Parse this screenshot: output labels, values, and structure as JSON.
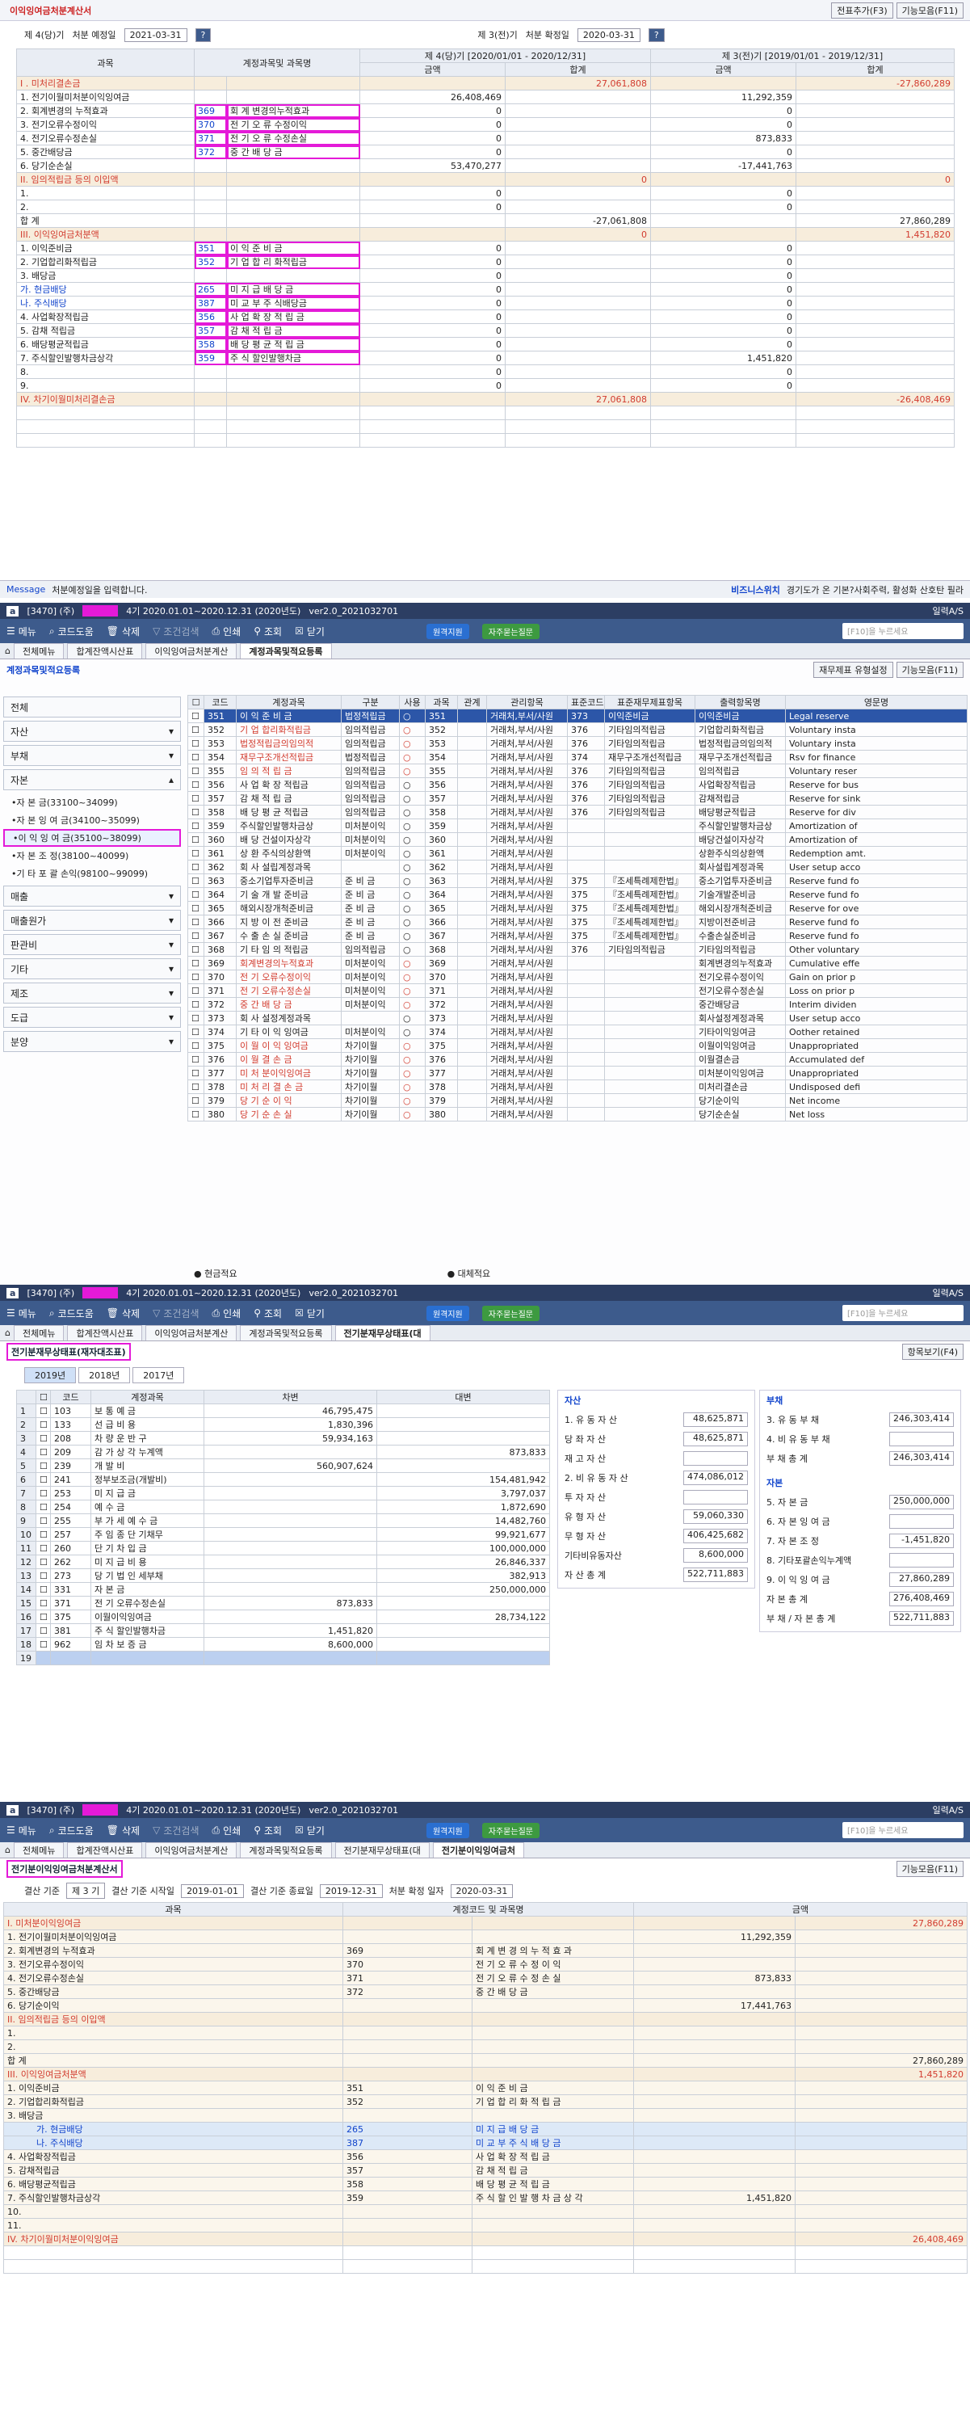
{
  "p1": {
    "title": "이익잉여금처분계산서",
    "btn_export": "전표추가(F3)",
    "btn_menu": "기능모음(F11)",
    "cur_label": "제 4(당)기",
    "cur_sub": "처분 예정일",
    "cur_date": "2021-03-31",
    "prev_label": "제 3(전)기",
    "prev_sub": "처분 확정일",
    "prev_date": "2020-03-31",
    "head": {
      "c1": "과목",
      "c2": "계정과목및 과목명",
      "c3": "제 4(당)기 [2020/01/01 - 2020/12/31]",
      "c4": "제 3(전)기 [2019/01/01 - 2019/12/31]",
      "amt": "금액",
      "sum": "합계"
    },
    "rows": [
      {
        "n": "I . 미처리결손금",
        "code": "",
        "acc": "",
        "a": "",
        "b": "27,061,808",
        "c": "",
        "d": "-27,860,289",
        "s": 1
      },
      {
        "n": "1. 전기이월미처분이익잉여금",
        "code": "",
        "acc": "",
        "a": "26,408,469",
        "b": "",
        "c": "11,292,359",
        "d": ""
      },
      {
        "n": "2. 회계변경의 누적효과",
        "code": "369",
        "acc": "회 계 변경의누적효과",
        "a": "0",
        "b": "",
        "c": "0",
        "d": ""
      },
      {
        "n": "3. 전기오류수정이익",
        "code": "370",
        "acc": "전 기 오 류 수정이익",
        "a": "0",
        "b": "",
        "c": "0",
        "d": ""
      },
      {
        "n": "4. 전기오류수정손실",
        "code": "371",
        "acc": "전 기 오 류 수정손실",
        "a": "0",
        "b": "",
        "c": "873,833",
        "d": ""
      },
      {
        "n": "5. 중간배당금",
        "code": "372",
        "acc": "중 간 배 당 금",
        "a": "0",
        "b": "",
        "c": "0",
        "d": ""
      },
      {
        "n": "6. 당기순손실",
        "code": "",
        "acc": "",
        "a": "53,470,277",
        "b": "",
        "c": "-17,441,763",
        "d": ""
      },
      {
        "n": "II. 임의적립금 등의 이입액",
        "code": "",
        "acc": "",
        "a": "",
        "b": "0",
        "c": "",
        "d": "0",
        "s": 1
      },
      {
        "n": "1.",
        "code": "",
        "acc": "",
        "a": "0",
        "b": "",
        "c": "0",
        "d": ""
      },
      {
        "n": "2.",
        "code": "",
        "acc": "",
        "a": "0",
        "b": "",
        "c": "0",
        "d": ""
      },
      {
        "n": "합 계",
        "code": "",
        "acc": "",
        "a": "",
        "b": "-27,061,808",
        "c": "",
        "d": "27,860,289"
      },
      {
        "n": "III. 이익잉여금처분액",
        "code": "",
        "acc": "",
        "a": "",
        "b": "0",
        "c": "",
        "d": "1,451,820",
        "s": 1
      },
      {
        "n": "1. 이익준비금",
        "code": "351",
        "acc": "이 익 준 비 금",
        "a": "0",
        "b": "",
        "c": "0",
        "d": ""
      },
      {
        "n": "2. 기업합리화적립금",
        "code": "352",
        "acc": "기 업 합 리 화적립금",
        "a": "0",
        "b": "",
        "c": "0",
        "d": ""
      },
      {
        "n": "3. 배당금",
        "code": "",
        "acc": "",
        "a": "0",
        "b": "",
        "c": "0",
        "d": ""
      },
      {
        "n": "가. 현금배당",
        "code": "265",
        "acc": "미 지 급 배 당 금",
        "a": "0",
        "b": "",
        "c": "0",
        "d": "",
        "bl": 1
      },
      {
        "n": "나. 주식배당",
        "code": "387",
        "acc": "미 교 부 주 식배당금",
        "a": "0",
        "b": "",
        "c": "0",
        "d": "",
        "bl": 1
      },
      {
        "n": "4. 사업확장적립금",
        "code": "356",
        "acc": "사 업 확 장 적 립 금",
        "a": "0",
        "b": "",
        "c": "0",
        "d": ""
      },
      {
        "n": "5. 감채 적립금",
        "code": "357",
        "acc": "감 채 적 립 금",
        "a": "0",
        "b": "",
        "c": "0",
        "d": ""
      },
      {
        "n": "6. 배당평균적립금",
        "code": "358",
        "acc": "배 당 평 균 적 립 금",
        "a": "0",
        "b": "",
        "c": "0",
        "d": ""
      },
      {
        "n": "7. 주식할인발행차금상각",
        "code": "359",
        "acc": "주 식 할인발행차금",
        "a": "0",
        "b": "",
        "c": "1,451,820",
        "d": ""
      },
      {
        "n": "8.",
        "code": "",
        "acc": "",
        "a": "0",
        "b": "",
        "c": "0",
        "d": ""
      },
      {
        "n": "9.",
        "code": "",
        "acc": "",
        "a": "0",
        "b": "",
        "c": "0",
        "d": ""
      },
      {
        "n": "IV. 차기이월미처리결손금",
        "code": "",
        "acc": "",
        "a": "",
        "b": "27,061,808",
        "c": "",
        "d": "-26,408,469",
        "s": 1
      }
    ],
    "msg_label": "Message",
    "msg": "처분예정일을 입력합니다.",
    "msg_right_a": "비즈니스위치",
    "msg_right_b": "경기도가 온 기본?사회주력, 활성화 산호탄 필라"
  },
  "app": {
    "code": "[3470] (주)",
    "period": "4기 2020.01.01~2020.12.31 (2020년도)",
    "ver": "ver2.0_2021032701",
    "right": "일력A/S",
    "search": "[F10]을 누르세요",
    "toolbar": [
      "메뉴",
      "코드도움",
      "삭제",
      "조건검색",
      "인쇄",
      "조회",
      "닫기"
    ],
    "pill1": "원격지원",
    "pill2": "자주묻는질문"
  },
  "p2": {
    "tabs": [
      "전체메뉴",
      "합계잔액시산표",
      "이익잉여금처분계산",
      "계정과목및적요등록"
    ],
    "title": "계정과목및적요등록",
    "btn1": "재무제표 유형설정",
    "btn2": "기능모음(F11)",
    "side": [
      "전체",
      "자산",
      "부채",
      "자본"
    ],
    "sub": [
      "•자 본 금(33100~34099)",
      "•자 본 잉 여 금(34100~35099)",
      "•이 익 잉 여 금(35100~38099)",
      "•자 본 조 정(38100~40099)",
      "•기 타 포 괄 손익(98100~99099)"
    ],
    "side2": [
      "매출",
      "매출원가",
      "판관비",
      "기타",
      "제조",
      "도급",
      "분양"
    ],
    "head": [
      "코드",
      "계정과목",
      "구분",
      "사용",
      "과목",
      "관계",
      "관리항목",
      "표준코드",
      "표준재무제표항목",
      "출력항목명",
      "영문명"
    ],
    "rows": [
      [
        "351",
        "이 익 준 비 금",
        "법정적립금",
        "○",
        "351",
        "",
        "거래처,부서/사원",
        "373",
        "이익준비금",
        "이익준비금",
        "Legal reserve"
      ],
      [
        "352",
        "기 업 합리화적립금",
        "임의적립금",
        "○",
        "352",
        "",
        "거래처,부서/사원",
        "376",
        "기타임의적립금",
        "기업합리화적립금",
        "Voluntary insta"
      ],
      [
        "353",
        "법정적립금의임의적",
        "임의적립금",
        "○",
        "353",
        "",
        "거래처,부서/사원",
        "376",
        "기타임의적립금",
        "법정적립금의임의적",
        "Voluntary insta"
      ],
      [
        "354",
        "재무구조개선적립금",
        "법정적립금",
        "○",
        "354",
        "",
        "거래처,부서/사원",
        "374",
        "재무구조개선적립금",
        "재무구조개선적립금",
        "Rsv for finance"
      ],
      [
        "355",
        "임 의 적 립 금",
        "임의적립금",
        "○",
        "355",
        "",
        "거래처,부서/사원",
        "376",
        "기타임의적립금",
        "임의적립금",
        "Voluntary reser"
      ],
      [
        "356",
        "사 업 확 장 적립금",
        "임의적립금",
        "○",
        "356",
        "",
        "거래처,부서/사원",
        "376",
        "기타임의적립금",
        "사업확장적립금",
        "Reserve for bus"
      ],
      [
        "357",
        "감 채 적 립 금",
        "임의적립금",
        "○",
        "357",
        "",
        "거래처,부서/사원",
        "376",
        "기타임의적립금",
        "감채적립금",
        "Reserve for sink"
      ],
      [
        "358",
        "배 당 평 균 적립금",
        "임의적립금",
        "○",
        "358",
        "",
        "거래처,부서/사원",
        "376",
        "기타임의적립금",
        "배당평균적립금",
        "Reserve for div"
      ],
      [
        "359",
        "주식할인발행차금상",
        "미처분이익",
        "○",
        "359",
        "",
        "거래처,부서/사원",
        "",
        "",
        "주식할인발행차금상",
        "Amortization of"
      ],
      [
        "360",
        "배 당 건설이자상각",
        "미처분이익",
        "○",
        "360",
        "",
        "거래처,부서/사원",
        "",
        "",
        "배당건설이자상각",
        "Amortization of"
      ],
      [
        "361",
        "상 환 주식의상환액",
        "미처분이익",
        "○",
        "361",
        "",
        "거래처,부서/사원",
        "",
        "",
        "상환주식의상환액",
        "Redemption amt."
      ],
      [
        "362",
        "회 사 설립계정과목",
        "",
        "○",
        "362",
        "",
        "거래처,부서/사원",
        "",
        "",
        "회사설립계정과목",
        "User setup acco"
      ],
      [
        "363",
        "중소기업투자준비금",
        "준 비 금",
        "○",
        "363",
        "",
        "거래처,부서/사원",
        "375",
        "『조세특례제한법』",
        "중소기업투자준비금",
        "Reserve fund fo"
      ],
      [
        "364",
        "기 술 개 발 준비금",
        "준 비 금",
        "○",
        "364",
        "",
        "거래처,부서/사원",
        "375",
        "『조세특례제한법』",
        "기술개발준비금",
        "Reserve fund fo"
      ],
      [
        "365",
        "해외시장개척준비금",
        "준 비 금",
        "○",
        "365",
        "",
        "거래처,부서/사원",
        "375",
        "『조세특례제한법』",
        "해외시장개척준비금",
        "Reserve for ove"
      ],
      [
        "366",
        "지 방 이 전 준비금",
        "준 비 금",
        "○",
        "366",
        "",
        "거래처,부서/사원",
        "375",
        "『조세특례제한법』",
        "지방이전준비금",
        "Reserve fund fo"
      ],
      [
        "367",
        "수 출 손 실 준비금",
        "준 비 금",
        "○",
        "367",
        "",
        "거래처,부서/사원",
        "375",
        "『조세특례제한법』",
        "수출손실준비금",
        "Reserve fund fo"
      ],
      [
        "368",
        "기 타 임 의 적립금",
        "임의적립금",
        "○",
        "368",
        "",
        "거래처,부서/사원",
        "376",
        "기타임의적립금",
        "기타임의적립금",
        "Other voluntary"
      ],
      [
        "369",
        "회계변경의누적효과",
        "미처분이익",
        "○",
        "369",
        "",
        "거래처,부서/사원",
        "",
        "",
        "회계변경의누적효과",
        "Cumulative effe"
      ],
      [
        "370",
        "전 기 오류수정이익",
        "미처분이익",
        "○",
        "370",
        "",
        "거래처,부서/사원",
        "",
        "",
        "전기오류수정이익",
        "Gain on prior p"
      ],
      [
        "371",
        "전 기 오류수정손실",
        "미처분이익",
        "○",
        "371",
        "",
        "거래처,부서/사원",
        "",
        "",
        "전기오류수정손실",
        "Loss on prior p"
      ],
      [
        "372",
        "중 간 배 당 금",
        "미처분이익",
        "○",
        "372",
        "",
        "거래처,부서/사원",
        "",
        "",
        "중간배당금",
        "Interim dividen"
      ],
      [
        "373",
        "회 사 설정계정과목",
        "",
        "○",
        "373",
        "",
        "거래처,부서/사원",
        "",
        "",
        "회사설정계정과목",
        "User setup acco"
      ],
      [
        "374",
        "기 타 이 익 잉여금",
        "미처분이익",
        "○",
        "374",
        "",
        "거래처,부서/사원",
        "",
        "",
        "기타이익잉여금",
        "Oother retained"
      ],
      [
        "375",
        "이 월 이 익 잉여금",
        "차기이월",
        "○",
        "375",
        "",
        "거래처,부서/사원",
        "",
        "",
        "이월이익잉여금",
        "Unappropriated"
      ],
      [
        "376",
        "이 월 결 손 금",
        "차기이월",
        "○",
        "376",
        "",
        "거래처,부서/사원",
        "",
        "",
        "이월결손금",
        "Accumulated def"
      ],
      [
        "377",
        "미 처 분이익잉여금",
        "차기이월",
        "○",
        "377",
        "",
        "거래처,부서/사원",
        "",
        "",
        "미처분이익잉여금",
        "Unappropriated"
      ],
      [
        "378",
        "미 처 리 결 손 금",
        "차기이월",
        "○",
        "378",
        "",
        "거래처,부서/사원",
        "",
        "",
        "미처리결손금",
        "Undisposed defi"
      ],
      [
        "379",
        "당 기 순 이 익",
        "차기이월",
        "○",
        "379",
        "",
        "거래처,부서/사원",
        "",
        "",
        "당기순이익",
        "Net income"
      ],
      [
        "380",
        "당 기 순 손 실",
        "차기이월",
        "○",
        "380",
        "",
        "거래처,부서/사원",
        "",
        "",
        "당기순손실",
        "Net loss"
      ]
    ],
    "legend1": "● 현금적요",
    "legend2": "● 대체적요"
  },
  "p3": {
    "tabs": [
      "전체메뉴",
      "합계잔액시산표",
      "이익잉여금처분계산",
      "계정과목및적요등록",
      "전기분재무상태표(대"
    ],
    "title": "전기분재무상태표(재자대조표)",
    "btn": "항목보기(F4)",
    "years": [
      "2019년",
      "2018년",
      "2017년"
    ],
    "head": [
      "코드",
      "계정과목",
      "차변",
      "대변"
    ],
    "rows": [
      [
        "1",
        "103",
        "보 통 예 금",
        "46,795,475",
        ""
      ],
      [
        "2",
        "133",
        "선 급 비 용",
        "1,830,396",
        ""
      ],
      [
        "3",
        "208",
        "차 량 운 반 구",
        "59,934,163",
        ""
      ],
      [
        "4",
        "209",
        "감 가 상 각 누계액",
        "",
        "873,833"
      ],
      [
        "5",
        "239",
        "개 발 비",
        "560,907,624",
        ""
      ],
      [
        "6",
        "241",
        "정부보조금(개발비)",
        "",
        "154,481,942"
      ],
      [
        "7",
        "253",
        "미 지 급 금",
        "",
        "3,797,037"
      ],
      [
        "8",
        "254",
        "예 수 금",
        "",
        "1,872,690"
      ],
      [
        "9",
        "255",
        "부 가 세 예 수 금",
        "",
        "14,482,760"
      ],
      [
        "10",
        "257",
        "주 임 종 단 기채무",
        "",
        "99,921,677"
      ],
      [
        "11",
        "260",
        "단 기 차 입 금",
        "",
        "100,000,000"
      ],
      [
        "12",
        "262",
        "미 지 급 비 용",
        "",
        "26,846,337"
      ],
      [
        "13",
        "273",
        "당 기 법 인 세부채",
        "",
        "382,913"
      ],
      [
        "14",
        "331",
        "자 본 금",
        "",
        "250,000,000"
      ],
      [
        "15",
        "371",
        "전 기 오류수정손실",
        "873,833",
        ""
      ],
      [
        "16",
        "375",
        "이월이익잉여금",
        "",
        "28,734,122"
      ],
      [
        "17",
        "381",
        "주 식 할인발행차금",
        "1,451,820",
        ""
      ],
      [
        "18",
        "962",
        "임 차 보 증 금",
        "8,600,000",
        ""
      ]
    ],
    "asset_t": "자산",
    "liab_t": "부채",
    "cap_t": "자본",
    "assets": [
      [
        "1. 유 동 자 산",
        "48,625,871"
      ],
      [
        "당 좌 자 산",
        "48,625,871"
      ],
      [
        "재 고 자 산",
        ""
      ],
      [
        "2. 비 유 동 자 산",
        "474,086,012"
      ],
      [
        "투 자 자 산",
        ""
      ],
      [
        "유 형 자 산",
        "59,060,330"
      ],
      [
        "무 형 자 산",
        "406,425,682"
      ],
      [
        "기타비유동자산",
        "8,600,000"
      ],
      [
        "자 산 총 계",
        "522,711,883"
      ]
    ],
    "liabs": [
      [
        "3. 유 동 부 채",
        "246,303,414"
      ],
      [
        "4. 비 유 동 부 채",
        ""
      ],
      [
        "부 채 총 계",
        "246,303,414"
      ]
    ],
    "caps": [
      [
        "5. 자 본 금",
        "250,000,000"
      ],
      [
        "6. 자 본 잉 여 금",
        ""
      ],
      [
        "7. 자 본 조 정",
        "-1,451,820"
      ],
      [
        "8. 기타포괄손익누계액",
        ""
      ],
      [
        "9. 이 익 잉 여 금",
        "27,860,289"
      ],
      [
        "자 본 총 계",
        "276,408,469"
      ],
      [
        "부 채 / 자 본 총 계",
        "522,711,883"
      ]
    ]
  },
  "p4": {
    "tabs": [
      "전체메뉴",
      "합계잔액시산표",
      "이익잉여금처분계산",
      "계정과목및적요등록",
      "전기분재무상태표(대",
      "전기분이익잉여금처"
    ],
    "title": "전기분이익잉여금처분계산서",
    "btn": "기능모음(F11)",
    "f": {
      "l1": "결산 기준",
      "v1": "제 3 기",
      "l2": "결산 기준 시작일",
      "v2": "2019-01-01",
      "l3": "결산 기준 종료일",
      "v3": "2019-12-31",
      "l4": "처분 확정 일자",
      "v4": "2020-03-31"
    },
    "head": [
      "과목",
      "계정코드 및 과목명",
      "",
      "금액",
      ""
    ],
    "rows": [
      [
        "I. 미처분이익잉여금",
        "",
        "",
        "",
        "27,860,289",
        "s"
      ],
      [
        "1. 전기이월미처분이익잉여금",
        "",
        "",
        "11,292,359",
        "",
        ""
      ],
      [
        "2. 회계변경의 누적효과",
        "369",
        "회 계 변 경 의 누 적 효 과",
        "",
        "",
        ""
      ],
      [
        "3. 전기오류수정이익",
        "370",
        "전 기 오 류 수 정 이 익",
        "",
        "",
        ""
      ],
      [
        "4. 전기오류수정손실",
        "371",
        "전 기 오 류 수 정 손 실",
        "873,833",
        "",
        ""
      ],
      [
        "5. 중간배당금",
        "372",
        "중 간 배 당 금",
        "",
        "",
        ""
      ],
      [
        "6. 당기순이익",
        "",
        "",
        "17,441,763",
        "",
        ""
      ],
      [
        "II. 임의적립금 등의 이입액",
        "",
        "",
        "",
        "",
        "s"
      ],
      [
        "1.",
        "",
        "",
        "",
        "",
        ""
      ],
      [
        "2.",
        "",
        "",
        "",
        "",
        ""
      ],
      [
        "합 계",
        "",
        "",
        "",
        "27,860,289",
        ""
      ],
      [
        "III. 이익잉여금처분액",
        "",
        "",
        "",
        "1,451,820",
        "s"
      ],
      [
        "1. 이익준비금",
        "351",
        "이 익 준 비 금",
        "",
        "",
        ""
      ],
      [
        "2. 기업합리화적립금",
        "352",
        "기 업 합 리 화 적 립 금",
        "",
        "",
        ""
      ],
      [
        "3. 배당금",
        "",
        "",
        "",
        "",
        ""
      ],
      [
        "가. 현금배당",
        "265",
        "미 지 급 배 당 금",
        "",
        "",
        "b"
      ],
      [
        "나. 주식배당",
        "387",
        "미 교 부 주 식 배 당 금",
        "",
        "",
        "b"
      ],
      [
        "4. 사업확장적립금",
        "356",
        "사 업 확 장 적 립 금",
        "",
        "",
        ""
      ],
      [
        "5. 감채적립금",
        "357",
        "감 채 적 립 금",
        "",
        "",
        ""
      ],
      [
        "6. 배당평균적립금",
        "358",
        "배 당 평 균 적 립 금",
        "",
        "",
        ""
      ],
      [
        "7. 주식할인발행차금상각",
        "359",
        "주 식 할 인 발 행 차 금 상 각",
        "1,451,820",
        "",
        ""
      ],
      [
        "10.",
        "",
        "",
        "",
        "",
        ""
      ],
      [
        "11.",
        "",
        "",
        "",
        "",
        ""
      ],
      [
        "IV. 차기이월미처분이익잉여금",
        "",
        "",
        "",
        "26,408,469",
        "s"
      ]
    ]
  }
}
